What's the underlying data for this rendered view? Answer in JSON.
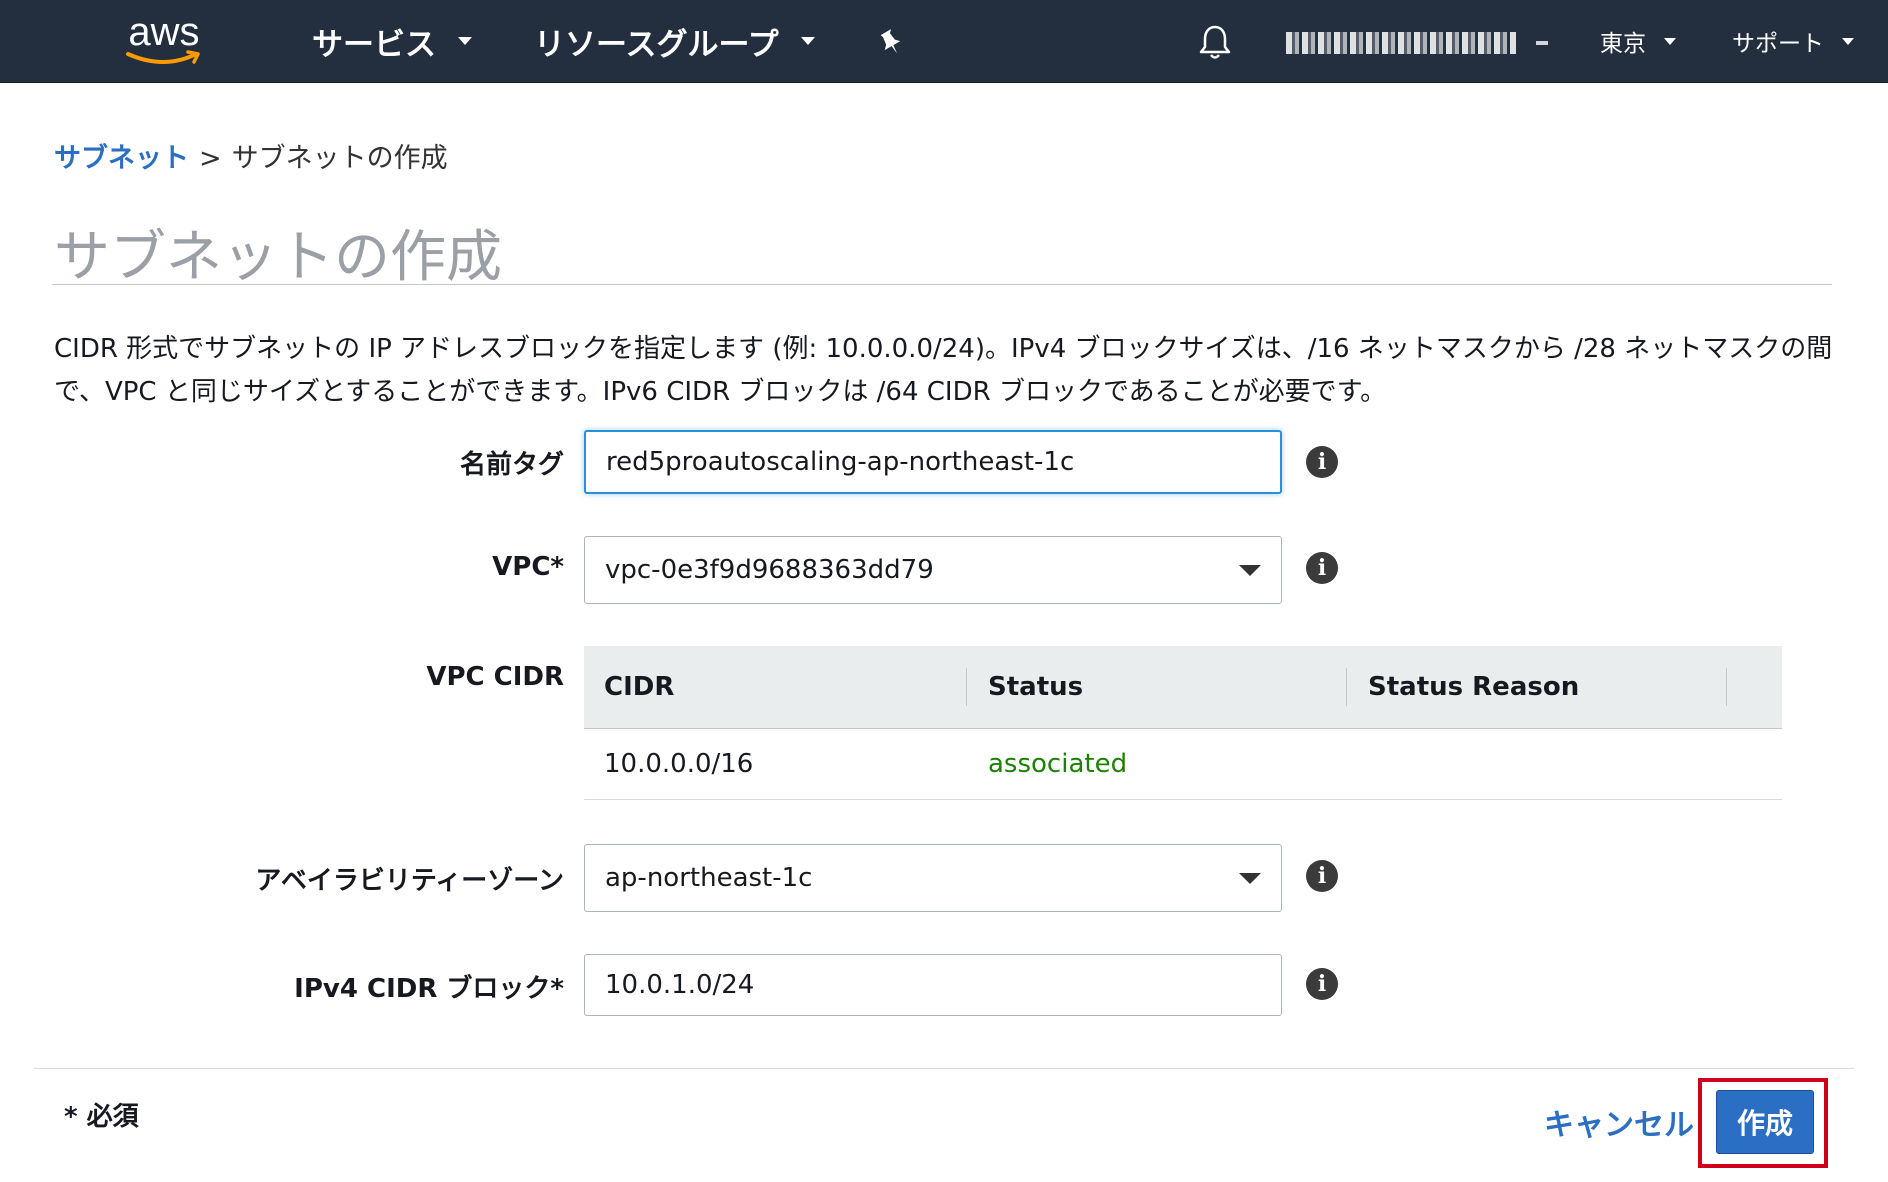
{
  "navbar": {
    "logo_text": "aws",
    "services_label": "サービス",
    "resource_groups_label": "リソースグループ",
    "region_label": "東京",
    "support_label": "サポート"
  },
  "breadcrumb": {
    "parent": "サブネット",
    "separator": ">",
    "current": "サブネットの作成"
  },
  "page": {
    "title": "サブネットの作成",
    "description": "CIDR 形式でサブネットの IP アドレスブロックを指定します (例: 10.0.0.0/24)。IPv4 ブロックサイズは、/16 ネットマスクから /28 ネットマスクの間で、VPC と同じサイズとすることができます。IPv6 CIDR ブロックは /64 CIDR ブロックであることが必要です。"
  },
  "form": {
    "name_tag": {
      "label": "名前タグ",
      "value": "red5proautoscaling-ap-northeast-1c"
    },
    "vpc": {
      "label": "VPC*",
      "value": "vpc-0e3f9d9688363dd79"
    },
    "vpc_cidr": {
      "label": "VPC CIDR",
      "columns": [
        "CIDR",
        "Status",
        "Status Reason"
      ],
      "rows": [
        {
          "cidr": "10.0.0.0/16",
          "status": "associated",
          "reason": ""
        }
      ]
    },
    "availability_zone": {
      "label": "アベイラビリティーゾーン",
      "value": "ap-northeast-1c"
    },
    "ipv4_cidr": {
      "label": "IPv4 CIDR ブロック*",
      "value": "10.0.1.0/24"
    },
    "info_glyph": "i"
  },
  "footer": {
    "required_note": "* 必須",
    "cancel_label": "キャンセル",
    "create_label": "作成"
  },
  "colors": {
    "navbar_bg": "#232f3e",
    "link_blue": "#2a6fc2",
    "status_green": "#1d8102",
    "primary_button": "#2b6fc4",
    "highlight_red": "#d0021b"
  }
}
